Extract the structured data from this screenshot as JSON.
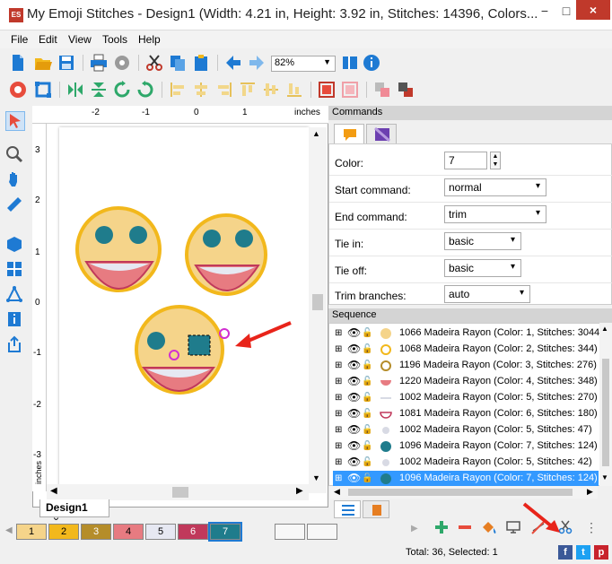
{
  "window": {
    "title": "My Emoji Stitches - Design1 (Width: 4.21 in, Height: 3.92 in, Stitches: 14396, Colors...",
    "app_icon_text": "ES",
    "minimize": "−",
    "maximize": "□",
    "close": "×"
  },
  "menu": [
    "File",
    "Edit",
    "View",
    "Tools",
    "Help"
  ],
  "toolbar": {
    "zoom": "82%"
  },
  "ruler": {
    "h_ticks": [
      "-2",
      "-1",
      "0",
      "1"
    ],
    "h_unit": "inches",
    "v_ticks": [
      "3",
      "2",
      "1",
      "0",
      "-1",
      "-2",
      "-3"
    ],
    "v_unit": "inches"
  },
  "doc_tab": {
    "label": "Design1",
    "close": "×"
  },
  "swatches": [
    {
      "label": "1",
      "color": "#f5d48a"
    },
    {
      "label": "2",
      "color": "#f2b81c"
    },
    {
      "label": "3",
      "color": "#b58d2a"
    },
    {
      "label": "4",
      "color": "#e77b81"
    },
    {
      "label": "5",
      "color": "#e6e8f2"
    },
    {
      "label": "6",
      "color": "#c0395b"
    },
    {
      "label": "7",
      "color": "#1f7c8c"
    }
  ],
  "commands": {
    "header": "Commands",
    "color_label": "Color:",
    "color_value": "7",
    "start_label": "Start command:",
    "start_value": "normal",
    "end_label": "End command:",
    "end_value": "trim",
    "tiein_label": "Tie in:",
    "tiein_value": "basic",
    "tieoff_label": "Tie off:",
    "tieoff_value": "basic",
    "trim_label": "Trim branches:",
    "trim_value": "auto"
  },
  "sequence": {
    "header": "Sequence",
    "rows": [
      {
        "text": "1066 Madeira Rayon (Color: 1, Stitches: 3044)",
        "swatch": "#f5d48a",
        "shape": "circle"
      },
      {
        "text": "1068 Madeira Rayon (Color: 2, Stitches: 344)",
        "swatch": "#f2b81c",
        "shape": "ring"
      },
      {
        "text": "1196 Madeira Rayon (Color: 3, Stitches: 276)",
        "swatch": "#b58d2a",
        "shape": "ring"
      },
      {
        "text": "1220 Madeira Rayon (Color: 4, Stitches: 348)",
        "swatch": "#e77b81",
        "shape": "half"
      },
      {
        "text": "1002 Madeira Rayon (Color: 5, Stitches: 270)",
        "swatch": "#d8dae4",
        "shape": "line"
      },
      {
        "text": "1081 Madeira Rayon (Color: 6, Stitches: 180)",
        "swatch": "#c0395b",
        "shape": "halfring"
      },
      {
        "text": "1002 Madeira Rayon (Color: 5, Stitches: 47)",
        "swatch": "#d8dae4",
        "shape": "dot"
      },
      {
        "text": "1096 Madeira Rayon (Color: 7, Stitches: 124)",
        "swatch": "#1f7c8c",
        "shape": "circle"
      },
      {
        "text": "1002 Madeira Rayon (Color: 5, Stitches: 42)",
        "swatch": "#d8dae4",
        "shape": "dot"
      },
      {
        "text": "1096 Madeira Rayon (Color: 7, Stitches: 124)",
        "swatch": "#1f7c8c",
        "shape": "circle",
        "selected": true
      }
    ]
  },
  "status": "Total: 36, Selected: 1",
  "social": [
    "f",
    "t",
    "p"
  ]
}
